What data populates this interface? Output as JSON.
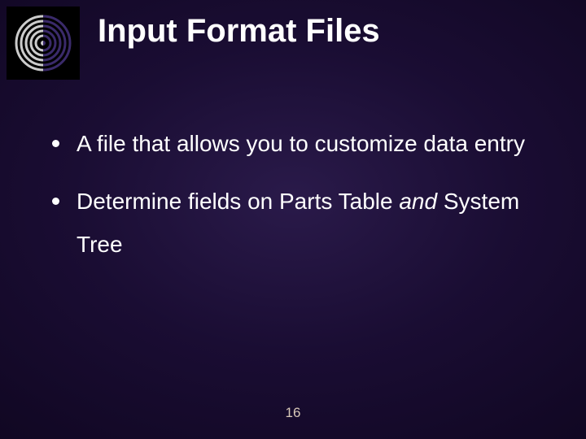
{
  "slide": {
    "title": "Input Format Files",
    "bullets": [
      {
        "text": "A file that allows you to customize data entry"
      },
      {
        "prefix": "Determine fields on Parts Table ",
        "italic": "and",
        "suffix": " System Tree"
      }
    ],
    "page_number": "16"
  }
}
